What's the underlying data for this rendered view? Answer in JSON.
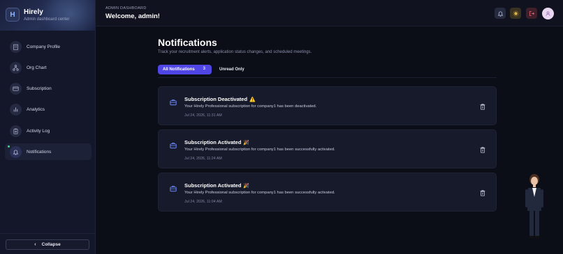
{
  "brand": {
    "name": "Hirely",
    "subtitle": "Admin dashboard center",
    "logo_letter": "H"
  },
  "sidebar": {
    "items": [
      {
        "label": "Company Profile",
        "icon": "building-icon"
      },
      {
        "label": "Org Chart",
        "icon": "org-chart-icon"
      },
      {
        "label": "Subscription",
        "icon": "credit-card-icon"
      },
      {
        "label": "Analytics",
        "icon": "bar-chart-icon"
      },
      {
        "label": "Activity Log",
        "icon": "clipboard-icon"
      },
      {
        "label": "Notifications",
        "icon": "bell-icon",
        "active": true
      }
    ],
    "collapse_label": "Collapse"
  },
  "header": {
    "eyebrow": "ADMIN DASHBOARD",
    "welcome": "Welcome, admin!"
  },
  "page": {
    "title": "Notifications",
    "subtitle": "Track your recruitment alerts, application status changes, and scheduled meetings."
  },
  "tabs": {
    "all_label": "All Notifications",
    "all_count": "3",
    "unread_label": "Unread Only"
  },
  "notifications": [
    {
      "title": "Subscription Deactivated",
      "emoji": "⚠️",
      "message": "Your Hirely Professional subscription for company1 has been deactivated.",
      "time": "Jul 24, 2026, 11:31 AM"
    },
    {
      "title": "Subscription Activated",
      "emoji": "🎉",
      "message": "Your Hirely Professional subscription for company1 has been successfully activated.",
      "time": "Jul 24, 2026, 11:24 AM"
    },
    {
      "title": "Subscription Activated",
      "emoji": "🎉",
      "message": "Your Hirely Professional subscription for company1 has been successfully activated.",
      "time": "Jul 24, 2026, 11:04 AM"
    }
  ],
  "colors": {
    "accent": "#4f46e5",
    "background": "#0b0d17",
    "sidebar": "#141729",
    "card": "#171a2b",
    "online_dot": "#3ddc84"
  }
}
